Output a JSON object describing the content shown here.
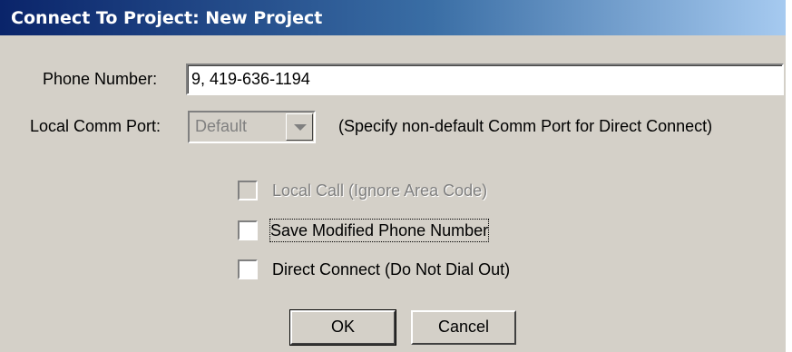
{
  "window": {
    "title": "Connect To Project:  New Project"
  },
  "phone": {
    "label": "Phone Number:",
    "value": "9, 419-636-1194"
  },
  "comm_port": {
    "label": "Local Comm Port:",
    "selected": "Default",
    "hint": "(Specify non-default Comm Port for Direct Connect)"
  },
  "options": {
    "local_call": {
      "label": "Local Call (Ignore Area Code)",
      "checked": false,
      "enabled": false
    },
    "save_modified": {
      "label": "Save Modified Phone Number",
      "checked": false,
      "enabled": true
    },
    "direct_connect": {
      "label": "Direct Connect (Do Not Dial Out)",
      "checked": false,
      "enabled": true
    }
  },
  "buttons": {
    "ok": "OK",
    "cancel": "Cancel"
  },
  "colors": {
    "dialog_face": "#d4d0c8",
    "title_start": "#0a246a",
    "title_end": "#a6caf0",
    "disabled_text": "#808080"
  }
}
